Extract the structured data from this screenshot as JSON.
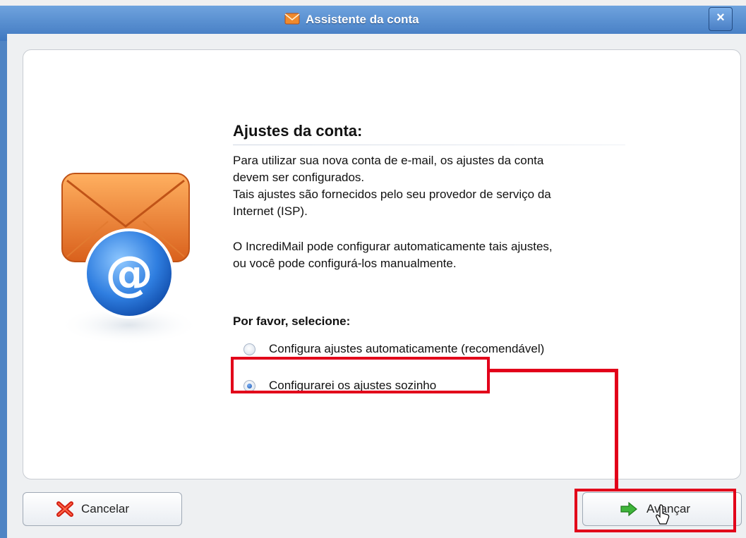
{
  "dialog": {
    "title": "Assistente da conta",
    "heading": "Ajustes da conta:",
    "paragraph1_lines": [
      "Para utilizar sua nova conta de e-mail, os ajustes da conta",
      "devem ser configurados.",
      "Tais ajustes são fornecidos pelo seu provedor de serviço da",
      "Internet (ISP)."
    ],
    "paragraph2_lines": [
      "O IncrediMail pode configurar automaticamente tais ajustes,",
      "ou você pode configurá-los manualmente."
    ],
    "prompt": "Por favor, selecione:",
    "options": [
      {
        "label": "Configura ajustes automaticamente (recomendável)",
        "selected": false
      },
      {
        "label": "Configurarei os ajustes sozinho",
        "selected": true
      }
    ],
    "buttons": {
      "cancel": "Cancelar",
      "next": "Avançar"
    }
  },
  "icons": {
    "title": "envelope-icon",
    "close": "close-icon",
    "main": "email-at-envelope-icon",
    "cancel": "red-x-icon",
    "next": "green-arrow-right-icon",
    "cursor": "mouse-cursor-icon"
  },
  "colors": {
    "highlight": "#e2001a",
    "titlebar": "#4f84c4"
  }
}
